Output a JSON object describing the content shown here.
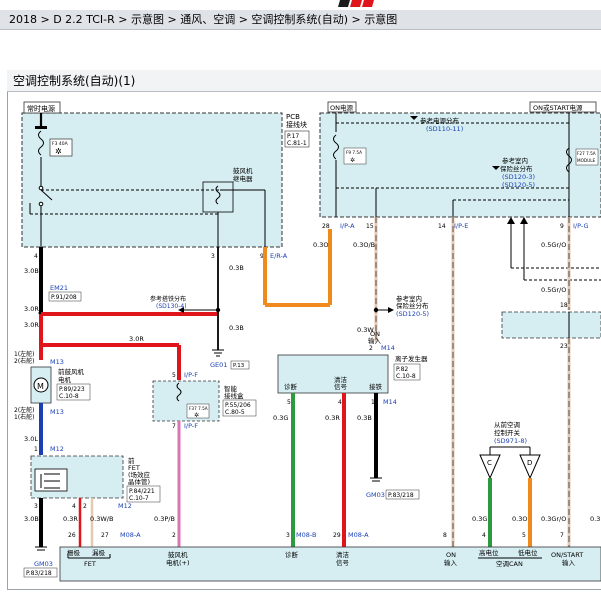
{
  "breadcrumb": "2018 > D 2.2 TCI-R > 示意图 > 通风、空调 > 空调控制系统(自动) > 示意图",
  "diagram_title": "空调控制系统(自动)(1)",
  "colors": {
    "red": "#e0151b",
    "orange": "#f08a1c",
    "green": "#2e9a3e",
    "pink": "#d977b4",
    "beige": "#e6c9b3",
    "blue_label": "#1a3fb5",
    "box_fill": "#d6eef2"
  },
  "labels": {
    "hot_power": "常时电源",
    "fuse_f3": "F3 40A",
    "pcb": "PCB",
    "pcb_block": "接线块",
    "pcb_ref1": "P.17",
    "pcb_ref2": "C.81-1",
    "blower_relay_1": "鼓风机",
    "blower_relay_2": "继电器",
    "on_power": "ON电源",
    "on_start_power": "ON或START电源",
    "ref_power_dist": "参考电源分布",
    "ref_power_dist_code": "(SD110-11)",
    "fuse_f9": "F9 7.5A",
    "fuse_f27": "F27 7.5A",
    "module": "MODULE",
    "ref_fuse_1": "参考室内",
    "ref_fuse_2": "保险丝分布",
    "ref_fuse_code1": "(SD120-3)",
    "ref_fuse_code2": "(SD120-5)",
    "pin_28": "28",
    "ip_a": "I/P-A",
    "pin_15": "15",
    "pin_14": "14",
    "ip_e": "I/P-E",
    "pin_9": "9",
    "ip_g": "I/P-G",
    "w_03o": "0.3O",
    "w_03ob": "0.3O/B",
    "w_05gro": "0.5Gr/O",
    "w_05gro2": "0.5Gr/O",
    "w_03w": "0.3W",
    "ref_fuse_right_1": "参考室内",
    "ref_fuse_right_2": "保险丝分布",
    "ref_fuse_right_code": "(SD120-5)",
    "on_input_1": "ON",
    "on_input_2": "输入",
    "pin_2": "2",
    "m14": "M14",
    "ionizer": "离子发生器",
    "ionizer_ref1": "P.82",
    "ionizer_ref2": "C.10-8",
    "diag": "诊断",
    "clean_sig": "清洁",
    "clean_sig2": "信号",
    "ground": "接铁",
    "pin_5": "5",
    "pin_4": "4",
    "pin_1": "1",
    "m14b": "M14",
    "w_03g": "0.3G",
    "w_03r": "0.3R",
    "w_03b": "0.3B",
    "ge03": "GM03",
    "ge03_ref": "P.83/218",
    "pin_4a": "4",
    "w_30b": "3.0B",
    "em21": "EM21",
    "em21_ref": "P.91/208",
    "w_30r": "3.0R",
    "pin_3": "3",
    "w_03b2": "0.3B",
    "pin_9b": "9",
    "e_ra": "E/R-A",
    "ref_ground": "参考搭铁分布",
    "ref_ground_code": "(SD130-4)",
    "w_03b3": "0.3B",
    "ge01": "GE01",
    "ge01_ref": "P.13",
    "w_30r2": "3.0R",
    "w_30r3": "3.0R",
    "pos_lhd": "1(左舵)",
    "pos_rhd": "2(右舵)",
    "m13": "M13",
    "blower_motor_1": "前鼓风机",
    "blower_motor_2": "电机",
    "blower_ref1": "P.89/223",
    "blower_ref2": "C.10-8",
    "pos_lhd2": "2(左舵)",
    "pos_rhd2": "1(右舵)",
    "m13b": "M13",
    "w_30l": "3.0L",
    "pin_1b": "1",
    "m12": "M12",
    "pin_5b": "5",
    "ip_f": "I/P-F",
    "smart_jb_1": "智能",
    "smart_jb_2": "接线盒",
    "smart_jb_ref1": "P.55/206",
    "smart_jb_ref2": "C.80-5",
    "fuse_f37": "F37 7.5A",
    "pin_7": "7",
    "ip_f2": "I/P-F",
    "fet_1": "前",
    "fet_2": "FET",
    "fet_3": "(场效应",
    "fet_4": "晶体管)",
    "fet_ref1": "P.84/221",
    "fet_ref2": "C.10-7",
    "pin_3b": "3",
    "pin_4b": "4",
    "pin_2b": "2",
    "m12b": "M12",
    "w_30b2": "3.0B",
    "w_03r2": "0.3R",
    "w_03wb": "0.3W/B",
    "w_03pb": "0.3P/B",
    "pin_26": "26",
    "pin_27": "27",
    "m08a": "M08-A",
    "pin_2c": "2",
    "gm03": "GM03",
    "gm03_ref": "P.83/218",
    "pin_3c": "3",
    "m08b": "M08-B",
    "pin_29": "29",
    "m08a2": "M08-A",
    "pin_8": "8",
    "ref_switch_1": "从前空调",
    "ref_switch_2": "控制开关",
    "ref_switch_code": "(SD971-8)",
    "conn_c": "C",
    "conn_d": "D",
    "w_03g2": "0.3G",
    "w_03o2": "0.3O",
    "w_03gro": "0.3Gr/O",
    "w_03x": "0.3",
    "pin_4c": "4",
    "pin_5c": "5",
    "pin_7b": "7",
    "pin_18": "18",
    "pin_23": "23",
    "bot_gate": "栅极",
    "bot_drain": "漏极",
    "bot_fet": "FET",
    "bot_blower_1": "鼓风机",
    "bot_blower_2": "电机(+)",
    "bot_diag": "诊断",
    "bot_clean_1": "清洁",
    "bot_clean_2": "信号",
    "bot_on_1": "ON",
    "bot_on_2": "输入",
    "bot_high": "高电位",
    "bot_low": "低电位",
    "bot_can": "空调CAN",
    "bot_onstart_1": "ON/START",
    "bot_onstart_2": "输入"
  }
}
